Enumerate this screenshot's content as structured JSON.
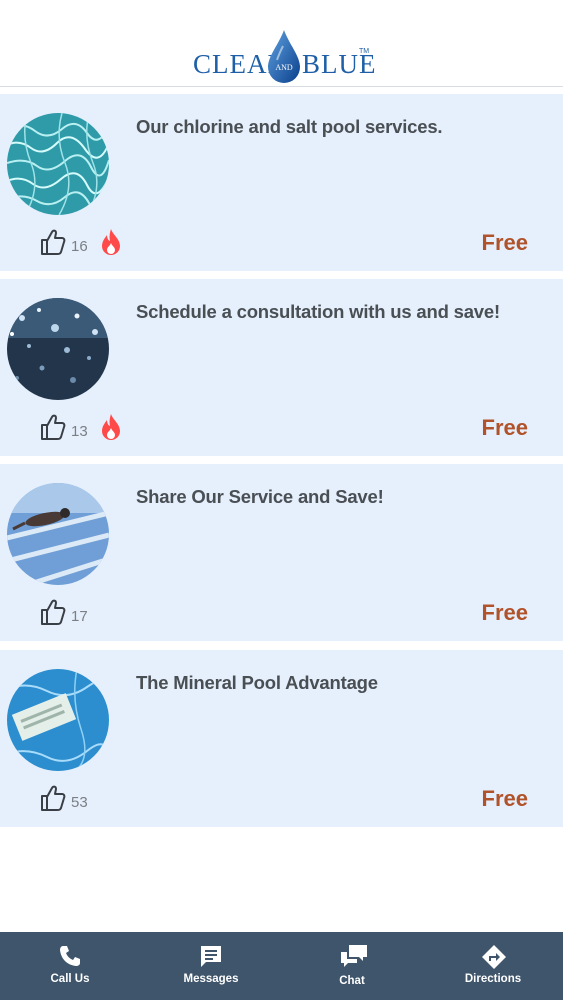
{
  "header": {
    "logo": {
      "left_word": "CLEAR",
      "middle_word": "AND",
      "right_word": "BLUE",
      "trademark": "TM"
    }
  },
  "colors": {
    "card_bg": "#e6f0fd",
    "price": "#b1532a",
    "title": "#4a4f54",
    "tabbar_bg": "#3f556b",
    "hot": "#ff4a4a",
    "logo": "#1f5fa8"
  },
  "deals": [
    {
      "title": "Our chlorine and salt pool services.",
      "likes": "16",
      "hot": true,
      "price": "Free",
      "image": "pool-water-caustics"
    },
    {
      "title": "Schedule a consultation with us and save!",
      "likes": "13",
      "hot": true,
      "price": "Free",
      "image": "dark-water-bubbles"
    },
    {
      "title": "Share Our Service and Save!",
      "likes": "17",
      "hot": false,
      "price": "Free",
      "image": "swimmer-in-lane"
    },
    {
      "title": "The Mineral Pool Advantage",
      "likes": "53",
      "hot": false,
      "price": "Free",
      "image": "mineral-cartridge-in-water"
    }
  ],
  "tabbar": {
    "tabs": [
      {
        "label": "Call Us",
        "icon": "phone-icon"
      },
      {
        "label": "Messages",
        "icon": "message-icon"
      },
      {
        "label": "Chat",
        "icon": "chat-icon"
      },
      {
        "label": "Directions",
        "icon": "directions-icon"
      }
    ]
  }
}
